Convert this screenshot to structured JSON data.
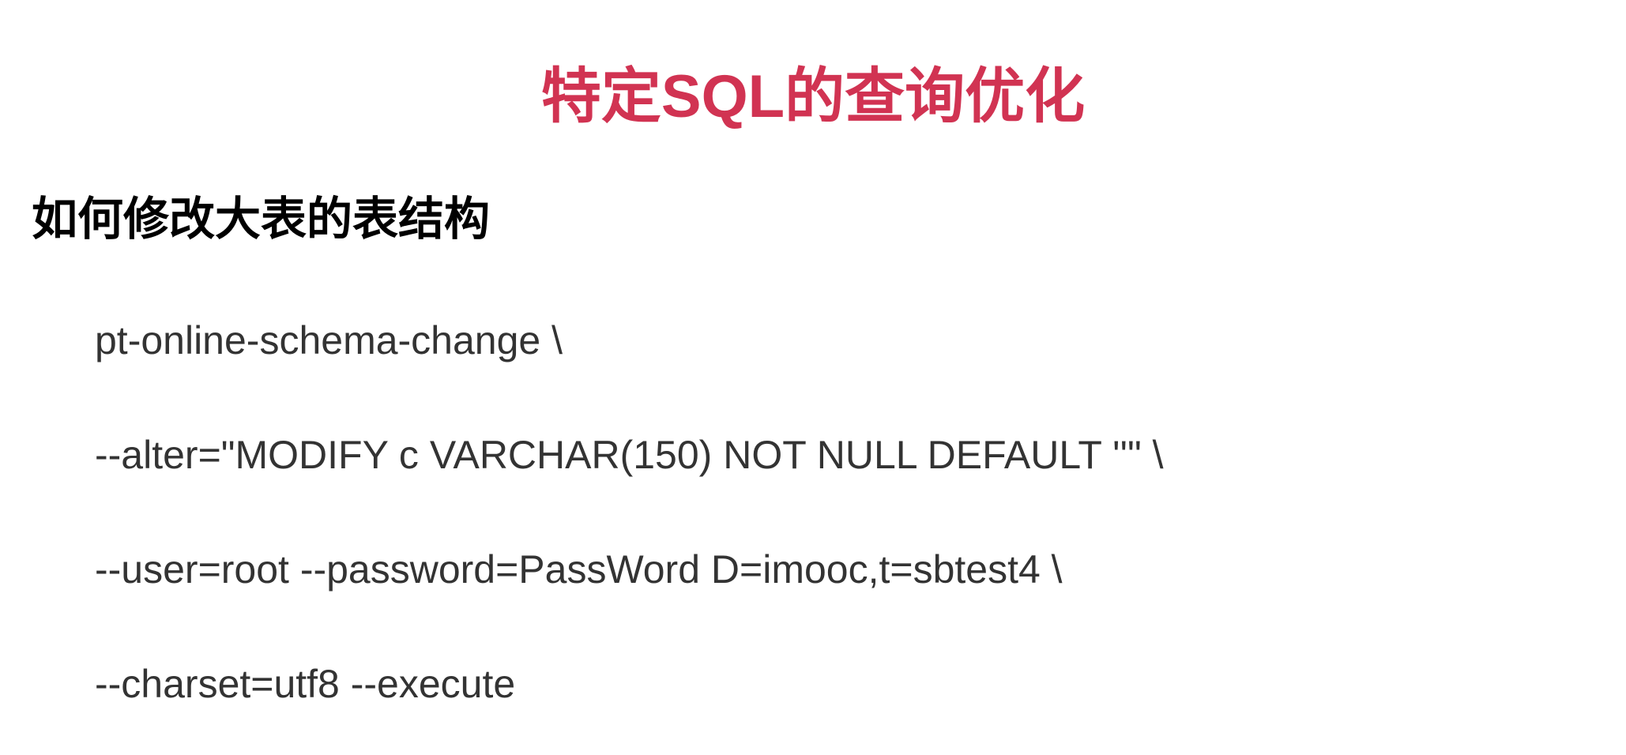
{
  "title": "特定SQL的查询优化",
  "subtitle": "如何修改大表的表结构",
  "code": {
    "line1": "pt-online-schema-change  \\",
    "line2": "--alter=\"MODIFY c VARCHAR(150) NOT NULL DEFAULT ''\"  \\",
    "line3": "--user=root --password=PassWord  D=imooc,t=sbtest4  \\",
    "line4": "--charset=utf8 --execute"
  }
}
